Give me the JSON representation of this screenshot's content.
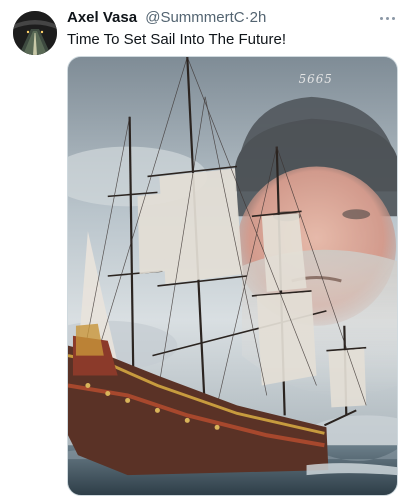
{
  "tweet": {
    "display_name": "Axel Vasa",
    "handle": "@SummmertC",
    "separator": "·",
    "time": "2h",
    "text": "Time To Set Sail Into The Future!",
    "beanie_text": "5665",
    "media_icon": "sailing-ship-image",
    "more_icon": "more-dots-icon"
  },
  "colors": {
    "text": "#0f1419",
    "secondary": "#536471",
    "border": "#cfd9de"
  }
}
